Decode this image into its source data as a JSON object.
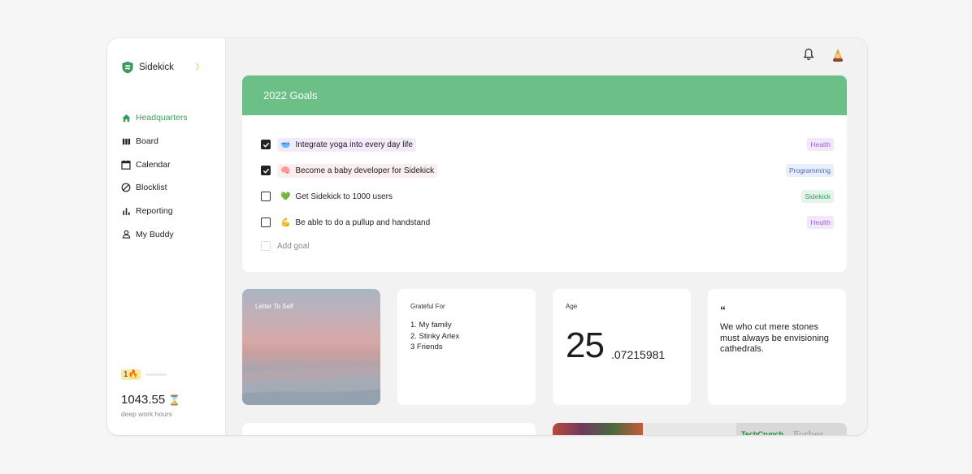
{
  "app": {
    "name": "Sidekick"
  },
  "nav": [
    {
      "label": "Headquarters",
      "icon": "home-icon",
      "active": true
    },
    {
      "label": "Board",
      "icon": "board-icon",
      "active": false
    },
    {
      "label": "Calendar",
      "icon": "calendar-icon",
      "active": false
    },
    {
      "label": "Blocklist",
      "icon": "block-icon",
      "active": false
    },
    {
      "label": "Reporting",
      "icon": "reporting-icon",
      "active": false
    },
    {
      "label": "My Buddy",
      "icon": "user-icon",
      "active": false
    }
  ],
  "streak": {
    "count": "1",
    "emoji": "🔥"
  },
  "deep_work": {
    "hours": "1043.55",
    "emoji": "⌛",
    "caption": "deep work hours"
  },
  "goals": {
    "title": "2022 Goals",
    "items": [
      {
        "emoji": "🥣",
        "text": "Integrate yoga into every day life",
        "tag": "Health",
        "checked": true
      },
      {
        "emoji": "🧠",
        "text": "Become a baby developer for Sidekick",
        "tag": "Programming",
        "checked": true
      },
      {
        "emoji": "💚",
        "text": "Get Sidekick to 1000 users",
        "tag": "Sidekick",
        "checked": false
      },
      {
        "emoji": "💪",
        "text": "Be able to do a pullup and handstand",
        "tag": "Health",
        "checked": false
      }
    ],
    "add_placeholder": "Add goal"
  },
  "cards": {
    "letter": {
      "label": "Letter To Self"
    },
    "grateful": {
      "label": "Grateful For",
      "items": [
        "1. My family",
        "2. Stinky Arlex",
        "3 Friends"
      ]
    },
    "age": {
      "label": "Age",
      "whole": "25",
      "fraction": ".07215981"
    },
    "quote": {
      "mark": "“",
      "text": "We who cut mere stones must always be envisioning cathedrals."
    }
  },
  "press": {
    "techcrunch": "TechCrunch",
    "forbes": "Forbes"
  },
  "colors": {
    "accent": "#6bbf87",
    "active_nav": "#3d9a5b"
  }
}
